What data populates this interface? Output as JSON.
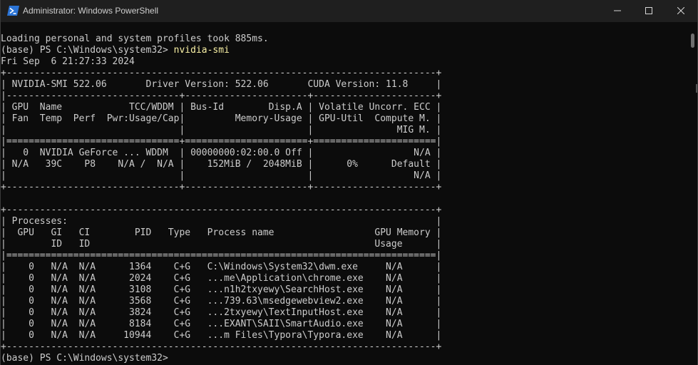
{
  "window": {
    "title": "Administrator: Windows PowerShell"
  },
  "colors": {
    "terminal_bg": "#0c0c0c",
    "terminal_fg": "#cccccc",
    "command_fg": "#f9f1a5",
    "titlebar_bg": "#1f1f1f",
    "icon_blue": "#2b74d6"
  },
  "icons": {
    "app": "powershell-icon",
    "minimize": "minimize-icon",
    "maximize": "maximize-icon",
    "close": "close-icon"
  },
  "terminal": {
    "line1": "Loading personal and system profiles took 885ms.",
    "prompt1": "(base) PS C:\\Windows\\system32> ",
    "command1": "nvidia-smi",
    "line3": "Fri Sep  6 21:27:33 2024",
    "line4": "+-----------------------------------------------------------------------------+",
    "line5": "| NVIDIA-SMI 522.06       Driver Version: 522.06       CUDA Version: 11.8     |",
    "line6": "|-------------------------------+----------------------+----------------------+",
    "line7": "| GPU  Name            TCC/WDDM | Bus-Id        Disp.A | Volatile Uncorr. ECC |",
    "line8": "| Fan  Temp  Perf  Pwr:Usage/Cap|         Memory-Usage | GPU-Util  Compute M. |",
    "line9": "|                               |                      |               MIG M. |",
    "line10": "|===============================+======================+======================|",
    "line11": "|   0  NVIDIA GeForce ... WDDM  | 00000000:02:00.0 Off |                  N/A |",
    "line12": "| N/A   39C    P8    N/A /  N/A |    152MiB /  2048MiB |      0%      Default |",
    "line13": "|                               |                      |                  N/A |",
    "line14": "+-------------------------------+----------------------+----------------------+",
    "line15": "",
    "line16": "+-----------------------------------------------------------------------------+",
    "line17": "| Processes:                                                                  |",
    "line18": "|  GPU   GI   CI        PID   Type   Process name                  GPU Memory |",
    "line19": "|        ID   ID                                                   Usage      |",
    "line20": "|=============================================================================|",
    "line21": "|    0   N/A  N/A      1364    C+G   C:\\Windows\\System32\\dwm.exe     N/A      |",
    "line22": "|    0   N/A  N/A      2024    C+G   ...me\\Application\\chrome.exe    N/A      |",
    "line23": "|    0   N/A  N/A      3108    C+G   ...n1h2txyewy\\SearchHost.exe    N/A      |",
    "line24": "|    0   N/A  N/A      3568    C+G   ...739.63\\msedgewebview2.exe    N/A      |",
    "line25": "|    0   N/A  N/A      3824    C+G   ...2txyewy\\TextInputHost.exe    N/A      |",
    "line26": "|    0   N/A  N/A      8184    C+G   ...EXANT\\SAII\\SmartAudio.exe    N/A      |",
    "line27": "|    0   N/A  N/A     10944    C+G   ...m Files\\Typora\\Typora.exe    N/A      |",
    "line28": "+-----------------------------------------------------------------------------+",
    "prompt2": "(base) PS C:\\Windows\\system32> "
  }
}
